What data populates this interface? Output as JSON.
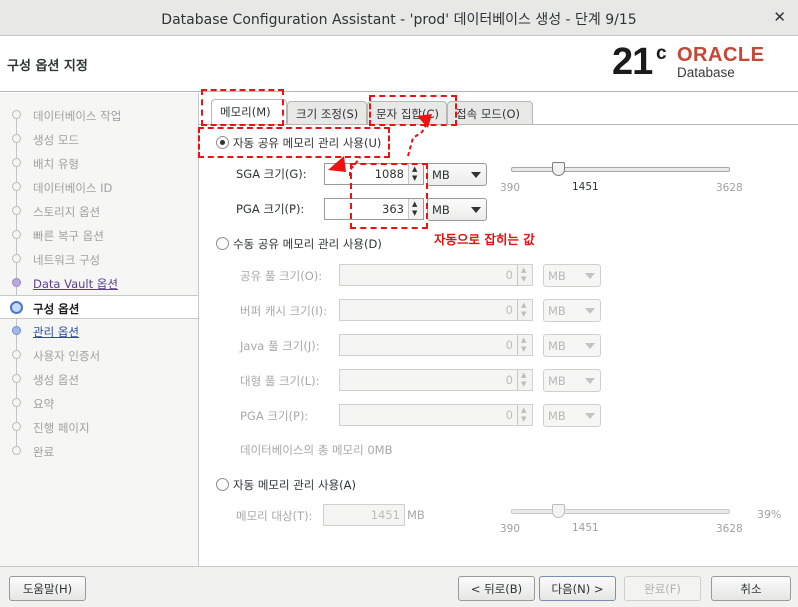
{
  "window": {
    "title": "Database Configuration Assistant - 'prod' 데이터베이스 생성 - 단계 9/15",
    "close_glyph": "✕"
  },
  "header": {
    "page_title": "구성 옵션 지정",
    "logo": {
      "version": "21",
      "suffix": "c",
      "brand": "ORACLE",
      "product": "Database"
    }
  },
  "steps": [
    {
      "label": "데이터베이스 작업",
      "state": "done"
    },
    {
      "label": "생성 모드",
      "state": "done"
    },
    {
      "label": "배치 유형",
      "state": "done"
    },
    {
      "label": "데이터베이스 ID",
      "state": "done"
    },
    {
      "label": "스토리지 옵션",
      "state": "done"
    },
    {
      "label": "빠른 복구 옵션",
      "state": "done"
    },
    {
      "label": "네트워크 구성",
      "state": "done"
    },
    {
      "label": "Data Vault 옵션",
      "state": "link"
    },
    {
      "label": "구성 옵션",
      "state": "active"
    },
    {
      "label": "관리 옵션",
      "state": "link"
    },
    {
      "label": "사용자 인증서",
      "state": "pending"
    },
    {
      "label": "생성 옵션",
      "state": "pending"
    },
    {
      "label": "요약",
      "state": "pending"
    },
    {
      "label": "진행 페이지",
      "state": "pending"
    },
    {
      "label": "완료",
      "state": "pending"
    }
  ],
  "tabs": [
    {
      "label": "메모리(M)",
      "selected": true
    },
    {
      "label": "크기 조정(S)",
      "selected": false
    },
    {
      "label": "문자 집합(C)",
      "selected": false
    },
    {
      "label": "접속 모드(O)",
      "selected": false
    }
  ],
  "memory": {
    "auto_shared": {
      "label": "자동 공유 메모리 관리 사용(U)",
      "selected": true,
      "sga_label": "SGA 크기(G):",
      "sga_value": "1088",
      "sga_unit": "MB",
      "pga_label": "PGA 크기(P):",
      "pga_value": "363",
      "pga_unit": "MB",
      "slider": {
        "min": "390",
        "value": "1451",
        "max": "3628",
        "fraction": 0.22
      }
    },
    "manual_shared": {
      "label": "수동 공유 메모리 관리 사용(D)",
      "selected": false,
      "fields": [
        {
          "label": "공유 풀 크기(O):",
          "value": "0",
          "unit": "MB"
        },
        {
          "label": "버퍼 캐시 크기(I):",
          "value": "0",
          "unit": "MB"
        },
        {
          "label": "Java 풀 크기(J):",
          "value": "0",
          "unit": "MB"
        },
        {
          "label": "대형 풀 크기(L):",
          "value": "0",
          "unit": "MB"
        },
        {
          "label": "PGA 크기(P):",
          "value": "0",
          "unit": "MB"
        }
      ],
      "total_text": "데이터베이스의 총 메모리 0MB"
    },
    "auto_memory": {
      "label": "자동 메모리 관리 사용(A)",
      "selected": false,
      "target_label": "메모리 대상(T):",
      "target_value": "1451",
      "target_unit": "MB",
      "slider": {
        "min": "390",
        "value": "1451",
        "max": "3628",
        "percent": "39%",
        "fraction": 0.22
      }
    }
  },
  "annotation": {
    "note": "자동으로 잡히는 값",
    "color": "#e31313"
  },
  "buttons": {
    "help": "도움말(H)",
    "back": "< 뒤로(B)",
    "next": "다음(N) >",
    "finish": "완료(F)",
    "cancel": "취소"
  }
}
